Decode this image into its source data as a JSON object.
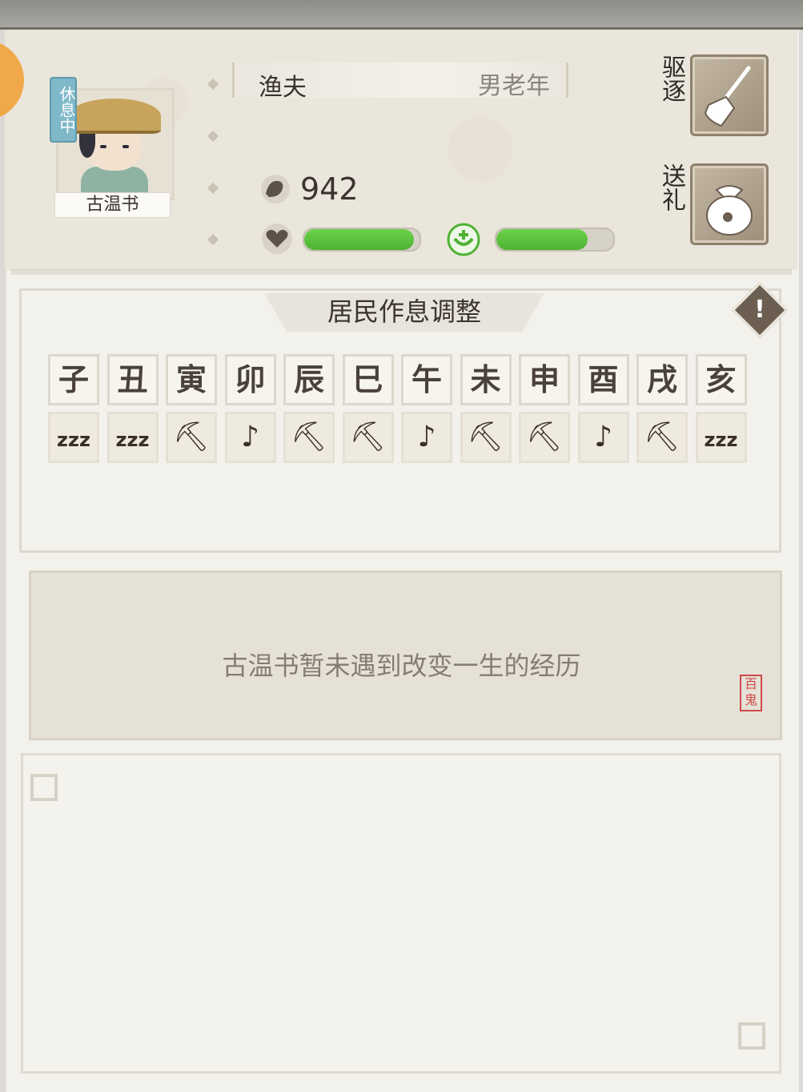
{
  "resident": {
    "name": "古温书",
    "status": "休息中",
    "occupation": "渔夫",
    "profile": "男老年",
    "coins": "942",
    "mood_percent": 95,
    "health_percent": 78
  },
  "actions": {
    "evict_label": "驱逐",
    "gift_label": "送礼"
  },
  "schedule": {
    "title": "居民作息调整",
    "info_symbol": "!",
    "hours": [
      "子",
      "丑",
      "寅",
      "卯",
      "辰",
      "巳",
      "午",
      "未",
      "申",
      "酉",
      "戌",
      "亥"
    ],
    "activities": [
      "sleep",
      "sleep",
      "work",
      "leisure",
      "work",
      "work",
      "leisure",
      "work",
      "work",
      "leisure",
      "work",
      "sleep"
    ]
  },
  "icons": {
    "sleep": "zzz",
    "work": "⛏",
    "leisure": "♪"
  },
  "experience": {
    "message": "古温书暂未遇到改变一生的经历",
    "seal": "百鬼"
  },
  "colors": {
    "bar_green": "#5cc43c",
    "status_badge": "#7fb8c8"
  }
}
